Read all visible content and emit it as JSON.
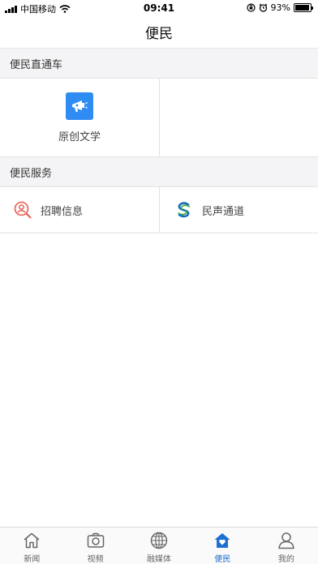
{
  "status_bar": {
    "carrier": "中国移动",
    "time": "09:41",
    "battery": "93%",
    "battery_level": 0.93
  },
  "navbar": {
    "title": "便民"
  },
  "sections": {
    "direct": {
      "title": "便民直通车"
    },
    "services": {
      "title": "便民服务"
    }
  },
  "direct_items": [
    {
      "label": "原创文学",
      "icon": "megaphone-icon"
    }
  ],
  "service_items": [
    {
      "label": "招聘信息",
      "icon": "search-person-icon"
    },
    {
      "label": "民声通道",
      "icon": "s-logo-icon"
    }
  ],
  "tabs": [
    {
      "label": "新闻",
      "icon": "home-icon"
    },
    {
      "label": "视频",
      "icon": "camera-icon"
    },
    {
      "label": "融媒体",
      "icon": "globe-icon"
    },
    {
      "label": "便民",
      "icon": "heart-house-icon",
      "active": true
    },
    {
      "label": "我的",
      "icon": "user-icon"
    }
  ],
  "colors": {
    "accent": "#1f6fd1",
    "tile_blue": "#2f8cf2",
    "recruit_red": "#e85a4f"
  }
}
